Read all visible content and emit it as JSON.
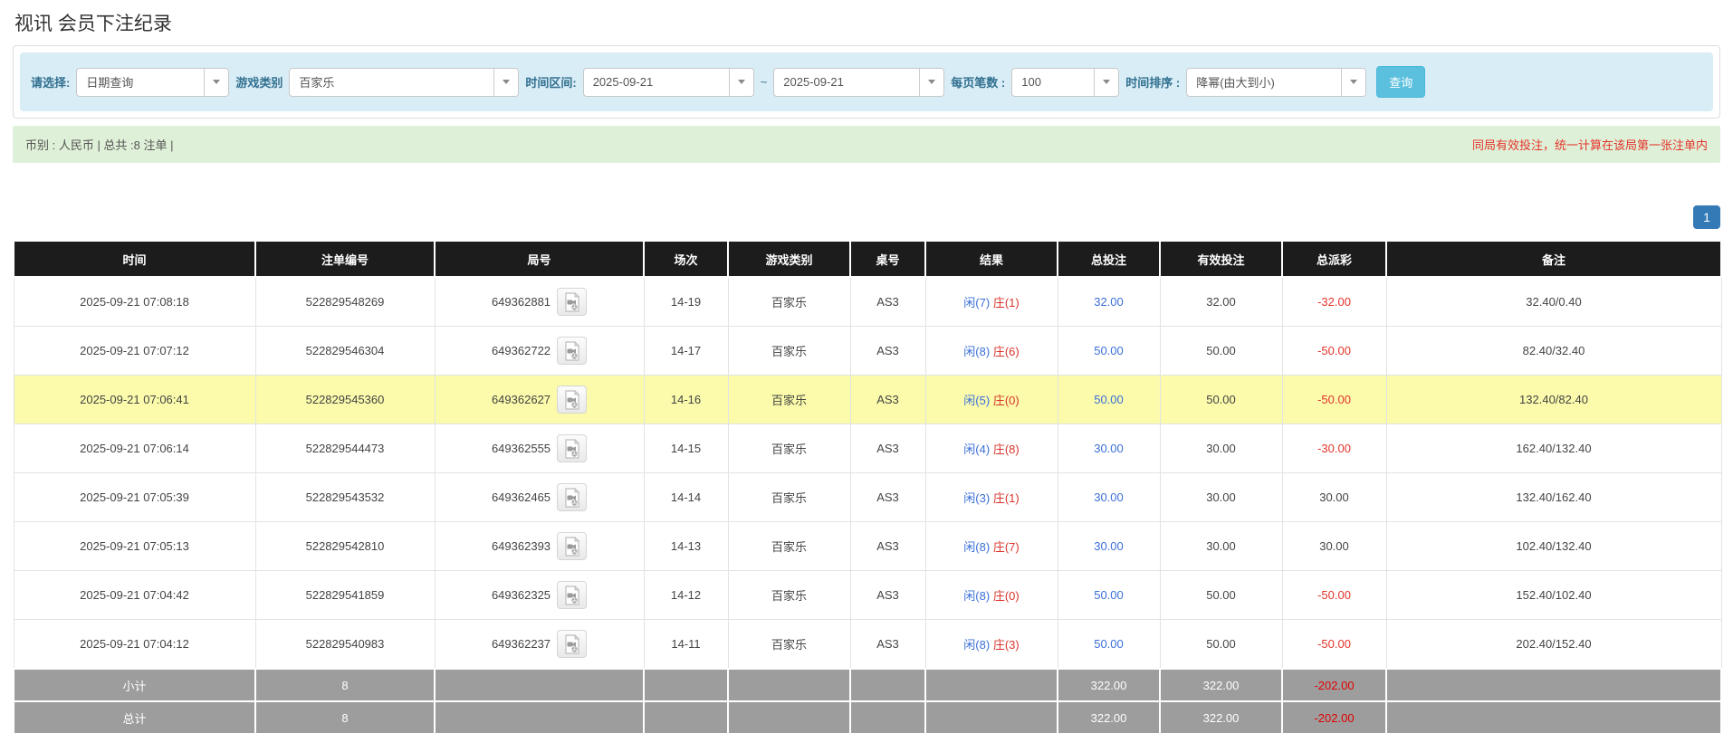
{
  "page_title": "视讯 会员下注纪录",
  "filters": {
    "select_label": "请选择:",
    "select_value": "日期查询",
    "game_type_label": "游戏类别",
    "game_type_value": "百家乐",
    "time_range_label": "时间区间:",
    "date_from": "2025-09-21",
    "range_separator": "~",
    "date_to": "2025-09-21",
    "page_size_label": "每页笔数 :",
    "page_size_value": "100",
    "sort_label": "时间排序 :",
    "sort_value": "降幂(由大到小)",
    "search_button": "查询"
  },
  "summary_bar": {
    "left_text": "币别 : 人民币 | 总共 :8 注单 |",
    "right_text": "同局有效投注，统一计算在该局第一张注单内"
  },
  "pagination": {
    "current_page": "1"
  },
  "table": {
    "headers": [
      "时间",
      "注单编号",
      "局号",
      "场次",
      "游戏类别",
      "桌号",
      "结果",
      "总投注",
      "有效投注",
      "总派彩",
      "备注"
    ],
    "rows": [
      {
        "time": "2025-09-21 07:08:18",
        "bet_no": "522829548269",
        "round_no": "649362881",
        "session": "14-19",
        "game_type": "百家乐",
        "table_no": "AS3",
        "result_player": "闲(7)",
        "result_banker": "庄(1)",
        "total_bet": "32.00",
        "valid_bet": "32.00",
        "payout": "-32.00",
        "remark": "32.40/0.40",
        "highlighted": false
      },
      {
        "time": "2025-09-21 07:07:12",
        "bet_no": "522829546304",
        "round_no": "649362722",
        "session": "14-17",
        "game_type": "百家乐",
        "table_no": "AS3",
        "result_player": "闲(8)",
        "result_banker": "庄(6)",
        "total_bet": "50.00",
        "valid_bet": "50.00",
        "payout": "-50.00",
        "remark": "82.40/32.40",
        "highlighted": false
      },
      {
        "time": "2025-09-21 07:06:41",
        "bet_no": "522829545360",
        "round_no": "649362627",
        "session": "14-16",
        "game_type": "百家乐",
        "table_no": "AS3",
        "result_player": "闲(5)",
        "result_banker": "庄(0)",
        "total_bet": "50.00",
        "valid_bet": "50.00",
        "payout": "-50.00",
        "remark": "132.40/82.40",
        "highlighted": true
      },
      {
        "time": "2025-09-21 07:06:14",
        "bet_no": "522829544473",
        "round_no": "649362555",
        "session": "14-15",
        "game_type": "百家乐",
        "table_no": "AS3",
        "result_player": "闲(4)",
        "result_banker": "庄(8)",
        "total_bet": "30.00",
        "valid_bet": "30.00",
        "payout": "-30.00",
        "remark": "162.40/132.40",
        "highlighted": false
      },
      {
        "time": "2025-09-21 07:05:39",
        "bet_no": "522829543532",
        "round_no": "649362465",
        "session": "14-14",
        "game_type": "百家乐",
        "table_no": "AS3",
        "result_player": "闲(3)",
        "result_banker": "庄(1)",
        "total_bet": "30.00",
        "valid_bet": "30.00",
        "payout": "30.00",
        "remark": "132.40/162.40",
        "highlighted": false
      },
      {
        "time": "2025-09-21 07:05:13",
        "bet_no": "522829542810",
        "round_no": "649362393",
        "session": "14-13",
        "game_type": "百家乐",
        "table_no": "AS3",
        "result_player": "闲(8)",
        "result_banker": "庄(7)",
        "total_bet": "30.00",
        "valid_bet": "30.00",
        "payout": "30.00",
        "remark": "102.40/132.40",
        "highlighted": false
      },
      {
        "time": "2025-09-21 07:04:42",
        "bet_no": "522829541859",
        "round_no": "649362325",
        "session": "14-12",
        "game_type": "百家乐",
        "table_no": "AS3",
        "result_player": "闲(8)",
        "result_banker": "庄(0)",
        "total_bet": "50.00",
        "valid_bet": "50.00",
        "payout": "-50.00",
        "remark": "152.40/102.40",
        "highlighted": false
      },
      {
        "time": "2025-09-21 07:04:12",
        "bet_no": "522829540983",
        "round_no": "649362237",
        "session": "14-11",
        "game_type": "百家乐",
        "table_no": "AS3",
        "result_player": "闲(8)",
        "result_banker": "庄(3)",
        "total_bet": "50.00",
        "valid_bet": "50.00",
        "payout": "-50.00",
        "remark": "202.40/152.40",
        "highlighted": false
      }
    ],
    "footer": {
      "subtotal": {
        "label": "小计",
        "count": "8",
        "total_bet": "322.00",
        "valid_bet": "322.00",
        "payout": "-202.00"
      },
      "total": {
        "label": "总计",
        "count": "8",
        "total_bet": "322.00",
        "valid_bet": "322.00",
        "payout": "-202.00"
      }
    }
  },
  "colors": {
    "accent_blue": "#5bc0de",
    "pagination_blue": "#337ab7",
    "link_blue": "#3a6fd8",
    "player_blue": "#3a6fd8",
    "banker_red": "#d9342b",
    "negative_red": "#e4342b",
    "highlight_yellow": "#fbfbab",
    "header_bg": "#1c1c1c",
    "footer_bg": "#9d9d9d",
    "filter_bg": "#d9edf7",
    "summary_bg": "#dff0d8"
  }
}
